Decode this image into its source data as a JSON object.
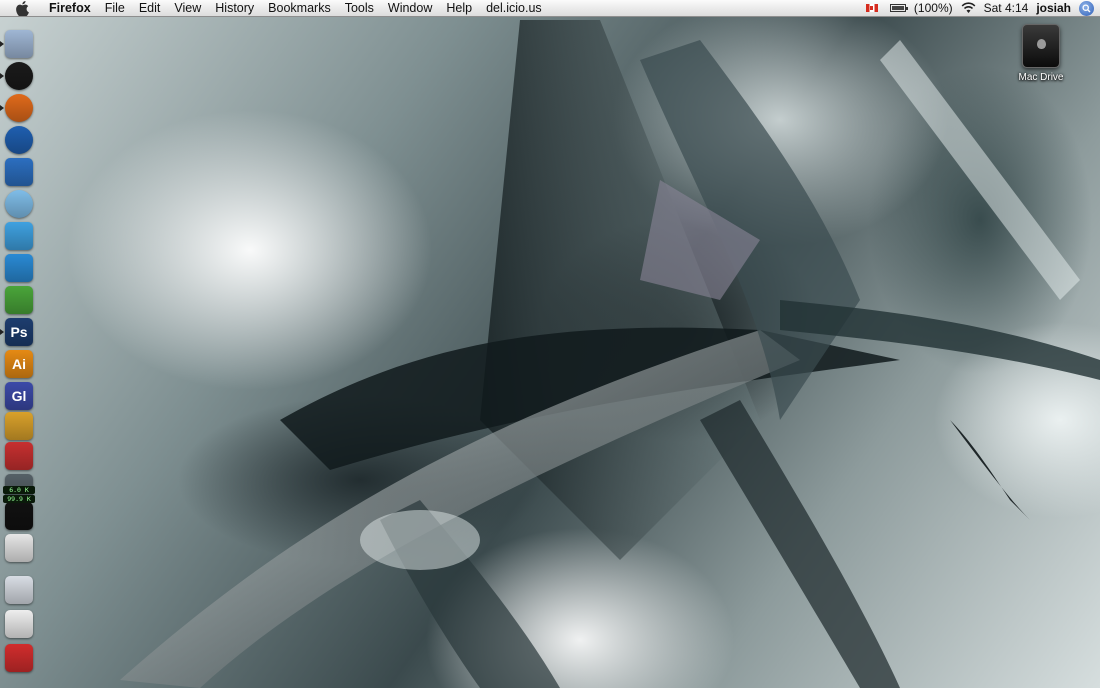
{
  "menubar": {
    "app_name": "Firefox",
    "items": [
      "File",
      "Edit",
      "View",
      "History",
      "Bookmarks",
      "Tools",
      "Window",
      "Help",
      "del.icio.us"
    ],
    "battery_text": "(100%)",
    "clock": "Sat 4:14",
    "user": "josiah"
  },
  "desktop": {
    "drive_label": "Mac Drive"
  },
  "dock": {
    "items": [
      {
        "name": "finder",
        "icon": "finder-icon",
        "color": "#9fb6d4",
        "running": true
      },
      {
        "name": "clock",
        "icon": "clock-icon",
        "color": "#1a1a1a",
        "running": true
      },
      {
        "name": "firefox",
        "icon": "firefox-icon",
        "color": "#e06a1b",
        "running": true
      },
      {
        "name": "internet",
        "icon": "globe-icon",
        "color": "#1f5fb0",
        "running": false
      },
      {
        "name": "photo",
        "icon": "photo-icon",
        "color": "#2c6fc0",
        "running": false
      },
      {
        "name": "itunes",
        "icon": "itunes-icon",
        "color": "#7fbde8",
        "running": false
      },
      {
        "name": "messenger",
        "icon": "messenger-icon",
        "color": "#3fa1e0",
        "running": false
      },
      {
        "name": "wordpress",
        "icon": "w-icon",
        "color": "#2a8ad4",
        "running": false
      },
      {
        "name": "network",
        "icon": "network-icon",
        "color": "#4aa53a",
        "running": false
      },
      {
        "name": "photoshop",
        "icon": "photoshop-icon",
        "color": "#1d3d6f",
        "label": "Ps",
        "running": true
      },
      {
        "name": "illustrator",
        "icon": "illustrator-icon",
        "color": "#e58a14",
        "label": "Ai",
        "running": false
      },
      {
        "name": "golive",
        "icon": "golive-icon",
        "color": "#3c4aa8",
        "label": "Gl",
        "running": false
      },
      {
        "name": "toy",
        "icon": "raygun-icon",
        "color": "#d9a12b",
        "running": false
      },
      {
        "name": "reminder",
        "icon": "stop-icon",
        "color": "#c73030",
        "running": false
      },
      {
        "name": "meter",
        "icon": "meter-icon",
        "color": "#556066",
        "running": false
      },
      {
        "name": "activity",
        "icon": "activity-monitor-icon",
        "color": "#111111",
        "running": false
      },
      {
        "name": "system",
        "icon": "apple-icon",
        "color": "#e6e6e6",
        "running": false
      },
      {
        "name": "applications",
        "icon": "applications-folder-icon",
        "color": "#d8dde4",
        "running": false
      },
      {
        "name": "documents",
        "icon": "documents-icon",
        "color": "#eeeeee",
        "running": false
      },
      {
        "name": "cube",
        "icon": "rubiks-cube-icon",
        "color": "#d12d2d",
        "running": false
      }
    ],
    "net_meter": {
      "up": "6.0 K",
      "down": "99.9 K"
    }
  }
}
